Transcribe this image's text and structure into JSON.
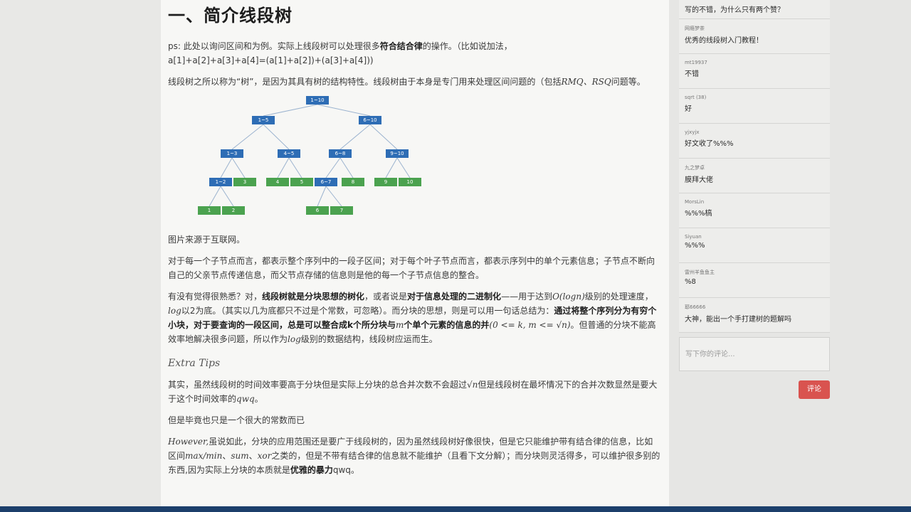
{
  "article": {
    "title": "一、简介线段树",
    "p1_a": "ps: 此处以询问区间和为例。实际上线段树可以处理很多",
    "p1_b": "符合结合律",
    "p1_c": "的操作。（比如说加法，",
    "p1_d": "a[1]+a[2]+a[3]+a[4]=(a[1]+a[2])+(a[3]+a[4]))",
    "p2_a": "线段树之所以称为“树”，是因为其具有树的结构特性。线段树由于本身是专门用来处理区间问题的（包括",
    "p2_m": "RMQ、RSQ",
    "p2_b": "问题等。",
    "tree_nodes": {
      "n1": "1~10",
      "n2": "1~5",
      "n3": "6~10",
      "n4": "1~3",
      "n5": "4~5",
      "n6": "6~8",
      "n7": "9~10",
      "n8": "1~2",
      "n9": "3",
      "n10": "4",
      "n11": "5",
      "n12": "6~7",
      "n13": "8",
      "n14": "9",
      "n15": "10",
      "n16": "1",
      "n17": "2",
      "n18": "6",
      "n19": "7"
    },
    "caption": "图片来源于互联网。",
    "p3": "对于每一个子节点而言，都表示整个序列中的一段子区间；对于每个叶子节点而言，都表示序列中的单个元素信息；子节点不断向自己的父亲节点传递信息，而父节点存储的信息则是他的每一个子节点信息的整合。",
    "p4_a": "有没有觉得很熟悉？对，",
    "p4_b": "线段树就是分块思想的树化",
    "p4_c": "，或者说是",
    "p4_d": "对于信息处理的二进制化",
    "p4_e": "——用于达到",
    "p4_m1": "O(logn)",
    "p4_f": "级别的处理速度，",
    "p4_m2": "log",
    "p4_g": "以2为底。（其实以几为底都只不过是个常数，可忽略）。而分块的思想，则是可以用一句话总结为：",
    "p4_h": "通过将整个序列分为有穷个小块，对于要查询的一段区间，总是可以整合成k个所分块与",
    "p4_m3": "m",
    "p4_i": "个单个元素的信息的并",
    "p4_m4": "(0 <= k, m <= √n)",
    "p4_j": "。但普通的分块不能高效率地解决很多问题，所以作为",
    "p4_m5": "log",
    "p4_k": "级别的数据结构，线段树应运而生。",
    "extra_tips": "Extra Tips",
    "p5_a": "其实，虽然线段树的时间效率要高于分块但是实际上分块的总合并次数不会超过",
    "p5_m": "√n",
    "p5_b": "但是线段树在最坏情况下的合并次数显然是要大于这个时间效率的",
    "p5_m2": "qwq",
    "p5_c": "。",
    "p6": "但是毕竟也只是一个很大的常数而已",
    "p7_m1": "However,",
    "p7_a": "虽说如此，分块的应用范围还是要广于线段树的，因为虽然线段树好像很快，但是它只能维护带有结合律的信息，比如区间",
    "p7_m2": "max/min",
    "p7_b": "、",
    "p7_m3": "sum",
    "p7_c": "、",
    "p7_m4": "xor",
    "p7_d": "之类的，但是不带有结合律的信息就不能维护（且看下文分解）；而分块则灵活得多，可以维护很多别的东西,因为实际上分块的本质就是",
    "p7_e": "优雅的暴力",
    "p7_f": "qwq。"
  },
  "comments": [
    {
      "user": "",
      "text": "写的不错，为什么只有两个赞？"
    },
    {
      "user": "网瘾梦茶",
      "text": "优秀的线段树入门教程！"
    },
    {
      "user": "mt19937",
      "text": "不错"
    },
    {
      "user": "sqrt (38)",
      "text": "好"
    },
    {
      "user": "yjxyjx",
      "text": "好文收了%%%"
    },
    {
      "user": "九之梦卓",
      "text": "膜拜大佬"
    },
    {
      "user": "MorsLin",
      "text": "%%%槁"
    },
    {
      "user": "Siyuan",
      "text": "%%%"
    },
    {
      "user": "雷州羊鱼鱼主",
      "text": "%8"
    },
    {
      "user": "耶66666",
      "text": "大神，能出一个手打建树的题解吗"
    }
  ],
  "comment_input": {
    "placeholder": "写下你的评论..."
  },
  "comment_button": {
    "label": "评论"
  }
}
